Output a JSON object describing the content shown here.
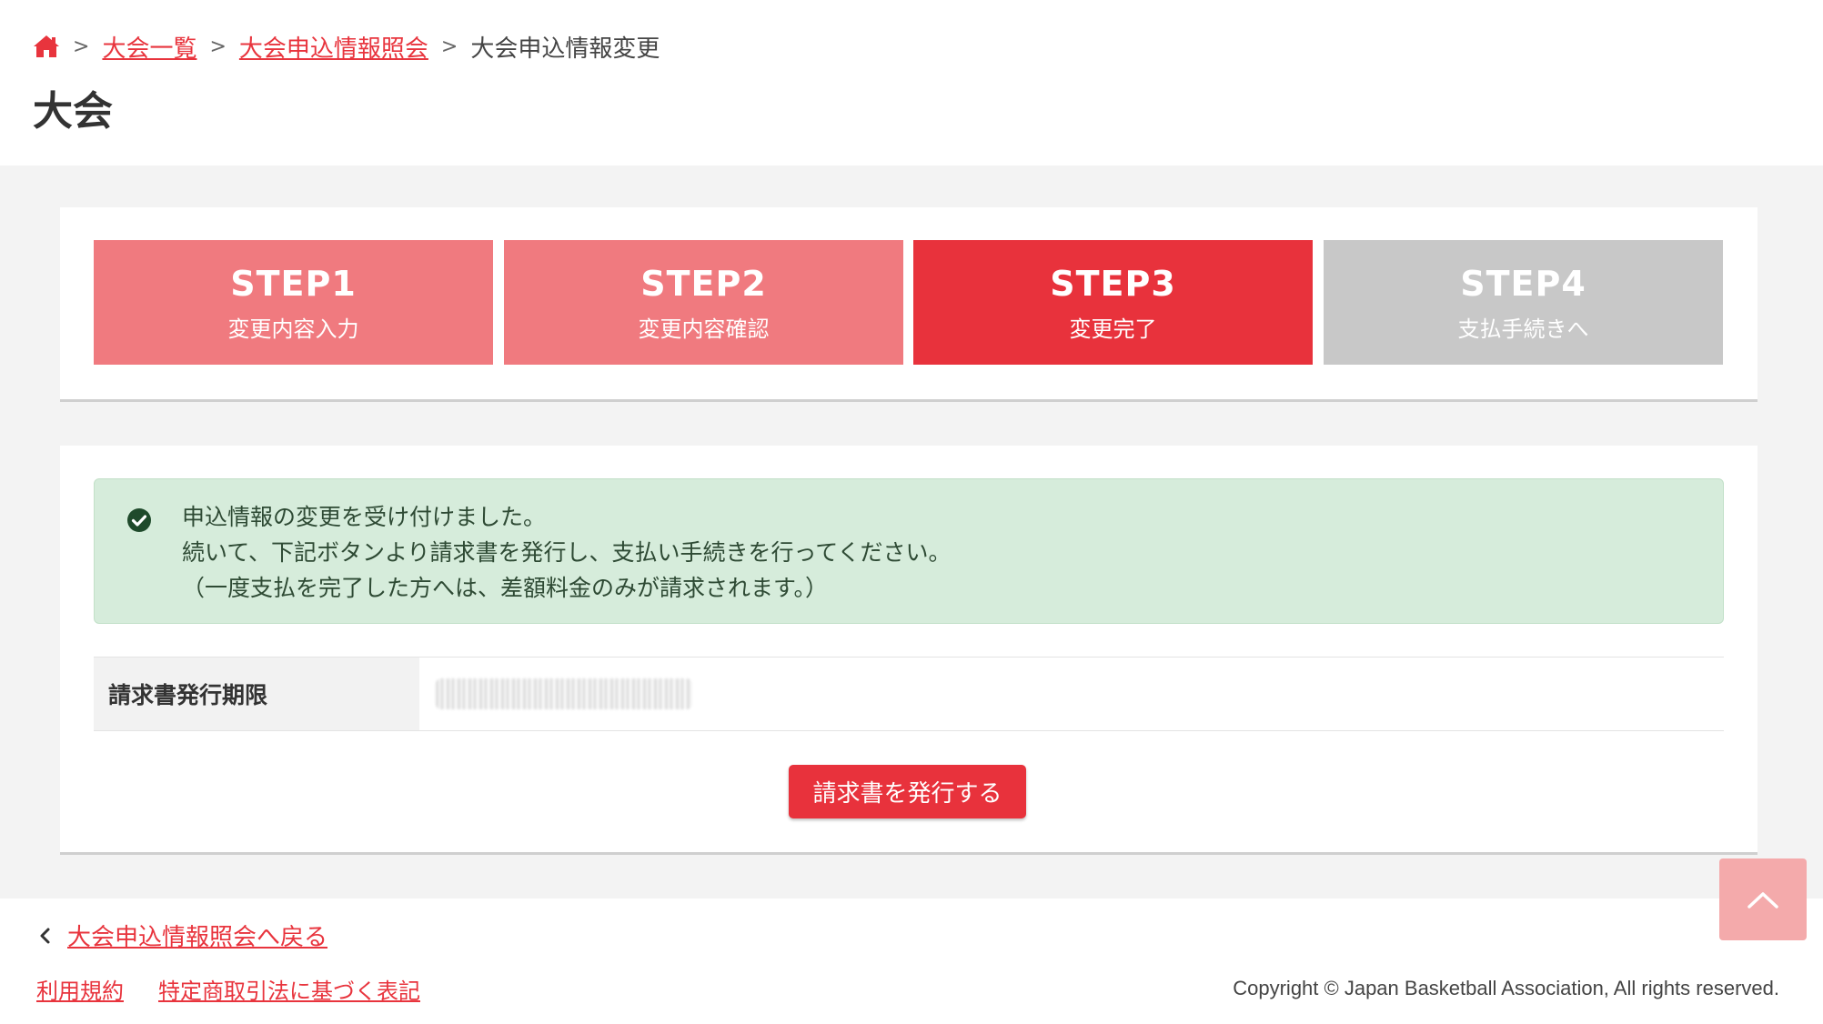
{
  "breadcrumb": {
    "home_icon": "home-icon",
    "items": [
      "大会一覧",
      "大会申込情報照会"
    ],
    "current": "大会申込情報変更"
  },
  "page_title": "大会",
  "steps": [
    {
      "num": "STEP1",
      "label": "変更内容入力",
      "state": "done"
    },
    {
      "num": "STEP2",
      "label": "変更内容確認",
      "state": "done"
    },
    {
      "num": "STEP3",
      "label": "変更完了",
      "state": "active"
    },
    {
      "num": "STEP4",
      "label": "支払手続きへ",
      "state": "todo"
    }
  ],
  "alert": {
    "icon": "check-circle-icon",
    "lines": [
      "申込情報の変更を受け付けました。",
      "続いて、下記ボタンより請求書を発行し、支払い手続きを行ってください。",
      "（一度支払を完了した方へは、差額料金のみが請求されます。）"
    ]
  },
  "invoice_table": {
    "label": "請求書発行期限"
  },
  "issue_button": "請求書を発行する",
  "footer": {
    "back_link": "大会申込情報照会へ戻る",
    "links": [
      "利用規約",
      "特定商取引法に基づく表記"
    ],
    "copyright": "Copyright © Japan Basketball Association, All rights reserved."
  },
  "colors": {
    "accent": "#e8323c",
    "step_done": "#f07a7f",
    "step_todo": "#c8c8c8",
    "alert_bg": "#d6ecdb",
    "page_top": "#f4aaab"
  }
}
